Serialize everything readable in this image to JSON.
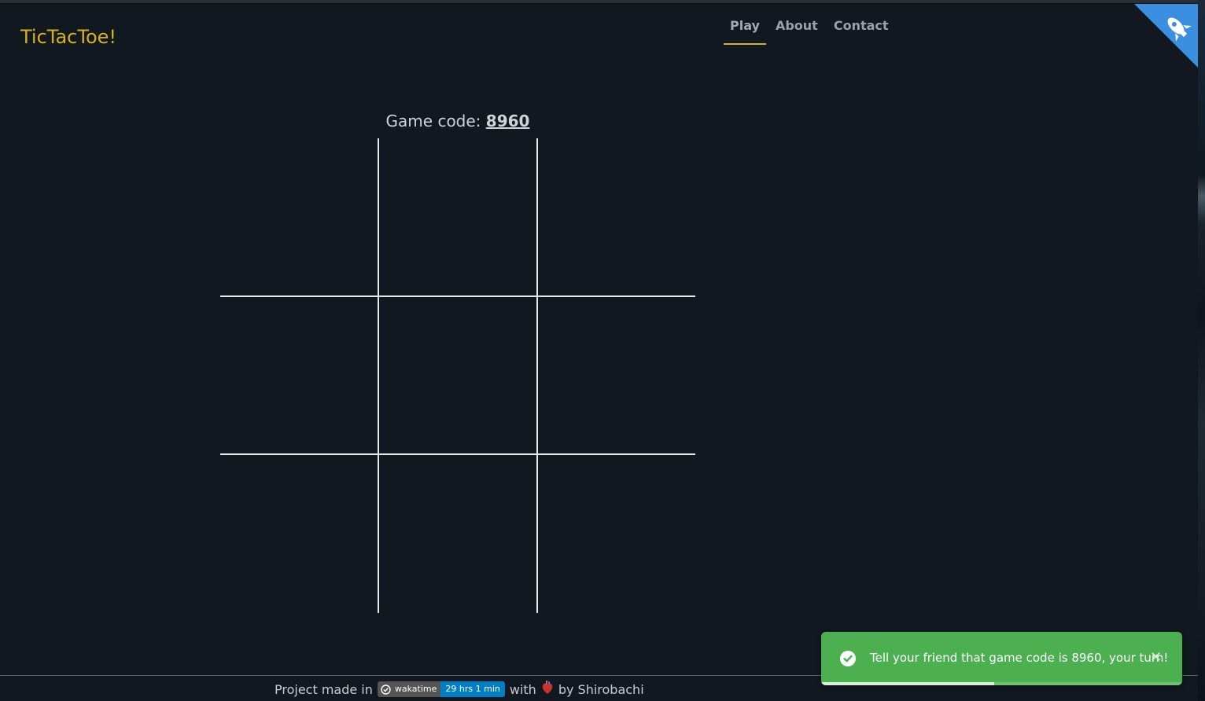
{
  "header": {
    "brand": "TicTacToe!",
    "nav": [
      {
        "label": "Play",
        "active": true
      },
      {
        "label": "About",
        "active": false
      },
      {
        "label": "Contact",
        "active": false
      }
    ],
    "corner_icon": "rocket-icon",
    "corner_color": "#3b8fe0"
  },
  "game": {
    "code_label": "Game code:",
    "code": "8960",
    "board": [
      "",
      "",
      "",
      "",
      "",
      "",
      "",
      "",
      ""
    ]
  },
  "footer": {
    "prefix": "Project made in",
    "badge_label": "wakatime",
    "badge_value": "29 hrs 1 min",
    "with": "with",
    "heart_icon": "anatomical-heart-icon",
    "suffix": "by Shirobachi"
  },
  "toast": {
    "icon": "check-circle-icon",
    "message": "Tell your friend that game code is 8960, your turn!",
    "close_icon": "close-icon",
    "progress_fraction": 0.48,
    "color": "#4caf50"
  },
  "colors": {
    "background": "#111820",
    "accent": "#d4b21e",
    "grid": "#e6e8ea"
  }
}
